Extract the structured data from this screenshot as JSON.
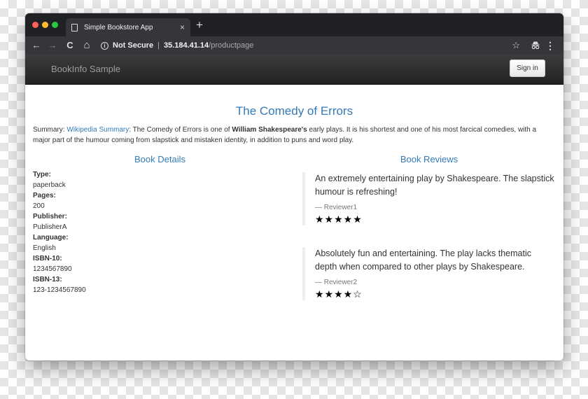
{
  "browser": {
    "tab_title": "Simple Bookstore App",
    "tab_close": "×",
    "new_tab": "+",
    "back": "←",
    "forward": "→",
    "reload": "C",
    "home": "⌂",
    "security_label": "Not Secure",
    "separator": "|",
    "url_host": "35.184.41.14",
    "url_path": "/productpage",
    "bookmark_star": "☆",
    "menu": "⋮"
  },
  "navbar": {
    "brand": "BookInfo Sample",
    "signin_label": "Sign in"
  },
  "book": {
    "title": "The Comedy of Errors",
    "summary_prefix": "Summary: ",
    "summary_link": "Wikipedia Summary",
    "summary_text_1": ": The Comedy of Errors is one of ",
    "summary_author": "William Shakespeare's",
    "summary_text_2": " early plays. It is his shortest and one of his most farcical comedies, with a major part of the humour coming from slapstick and mistaken identity, in addition to puns and word play."
  },
  "details": {
    "heading": "Book Details",
    "items": [
      {
        "label": "Type:",
        "value": "paperback"
      },
      {
        "label": "Pages:",
        "value": "200"
      },
      {
        "label": "Publisher:",
        "value": "PublisherA"
      },
      {
        "label": "Language:",
        "value": "English"
      },
      {
        "label": "ISBN-10:",
        "value": "1234567890"
      },
      {
        "label": "ISBN-13:",
        "value": "123-1234567890"
      }
    ]
  },
  "reviews": {
    "heading": "Book Reviews",
    "items": [
      {
        "text": "An extremely entertaining play by Shakespeare. The slapstick humour is refreshing!",
        "author": "— Reviewer1",
        "stars": "★★★★★"
      },
      {
        "text": "Absolutely fun and entertaining. The play lacks thematic depth when compared to other plays by Shakespeare.",
        "author": "— Reviewer2",
        "stars": "★★★★☆"
      }
    ]
  }
}
